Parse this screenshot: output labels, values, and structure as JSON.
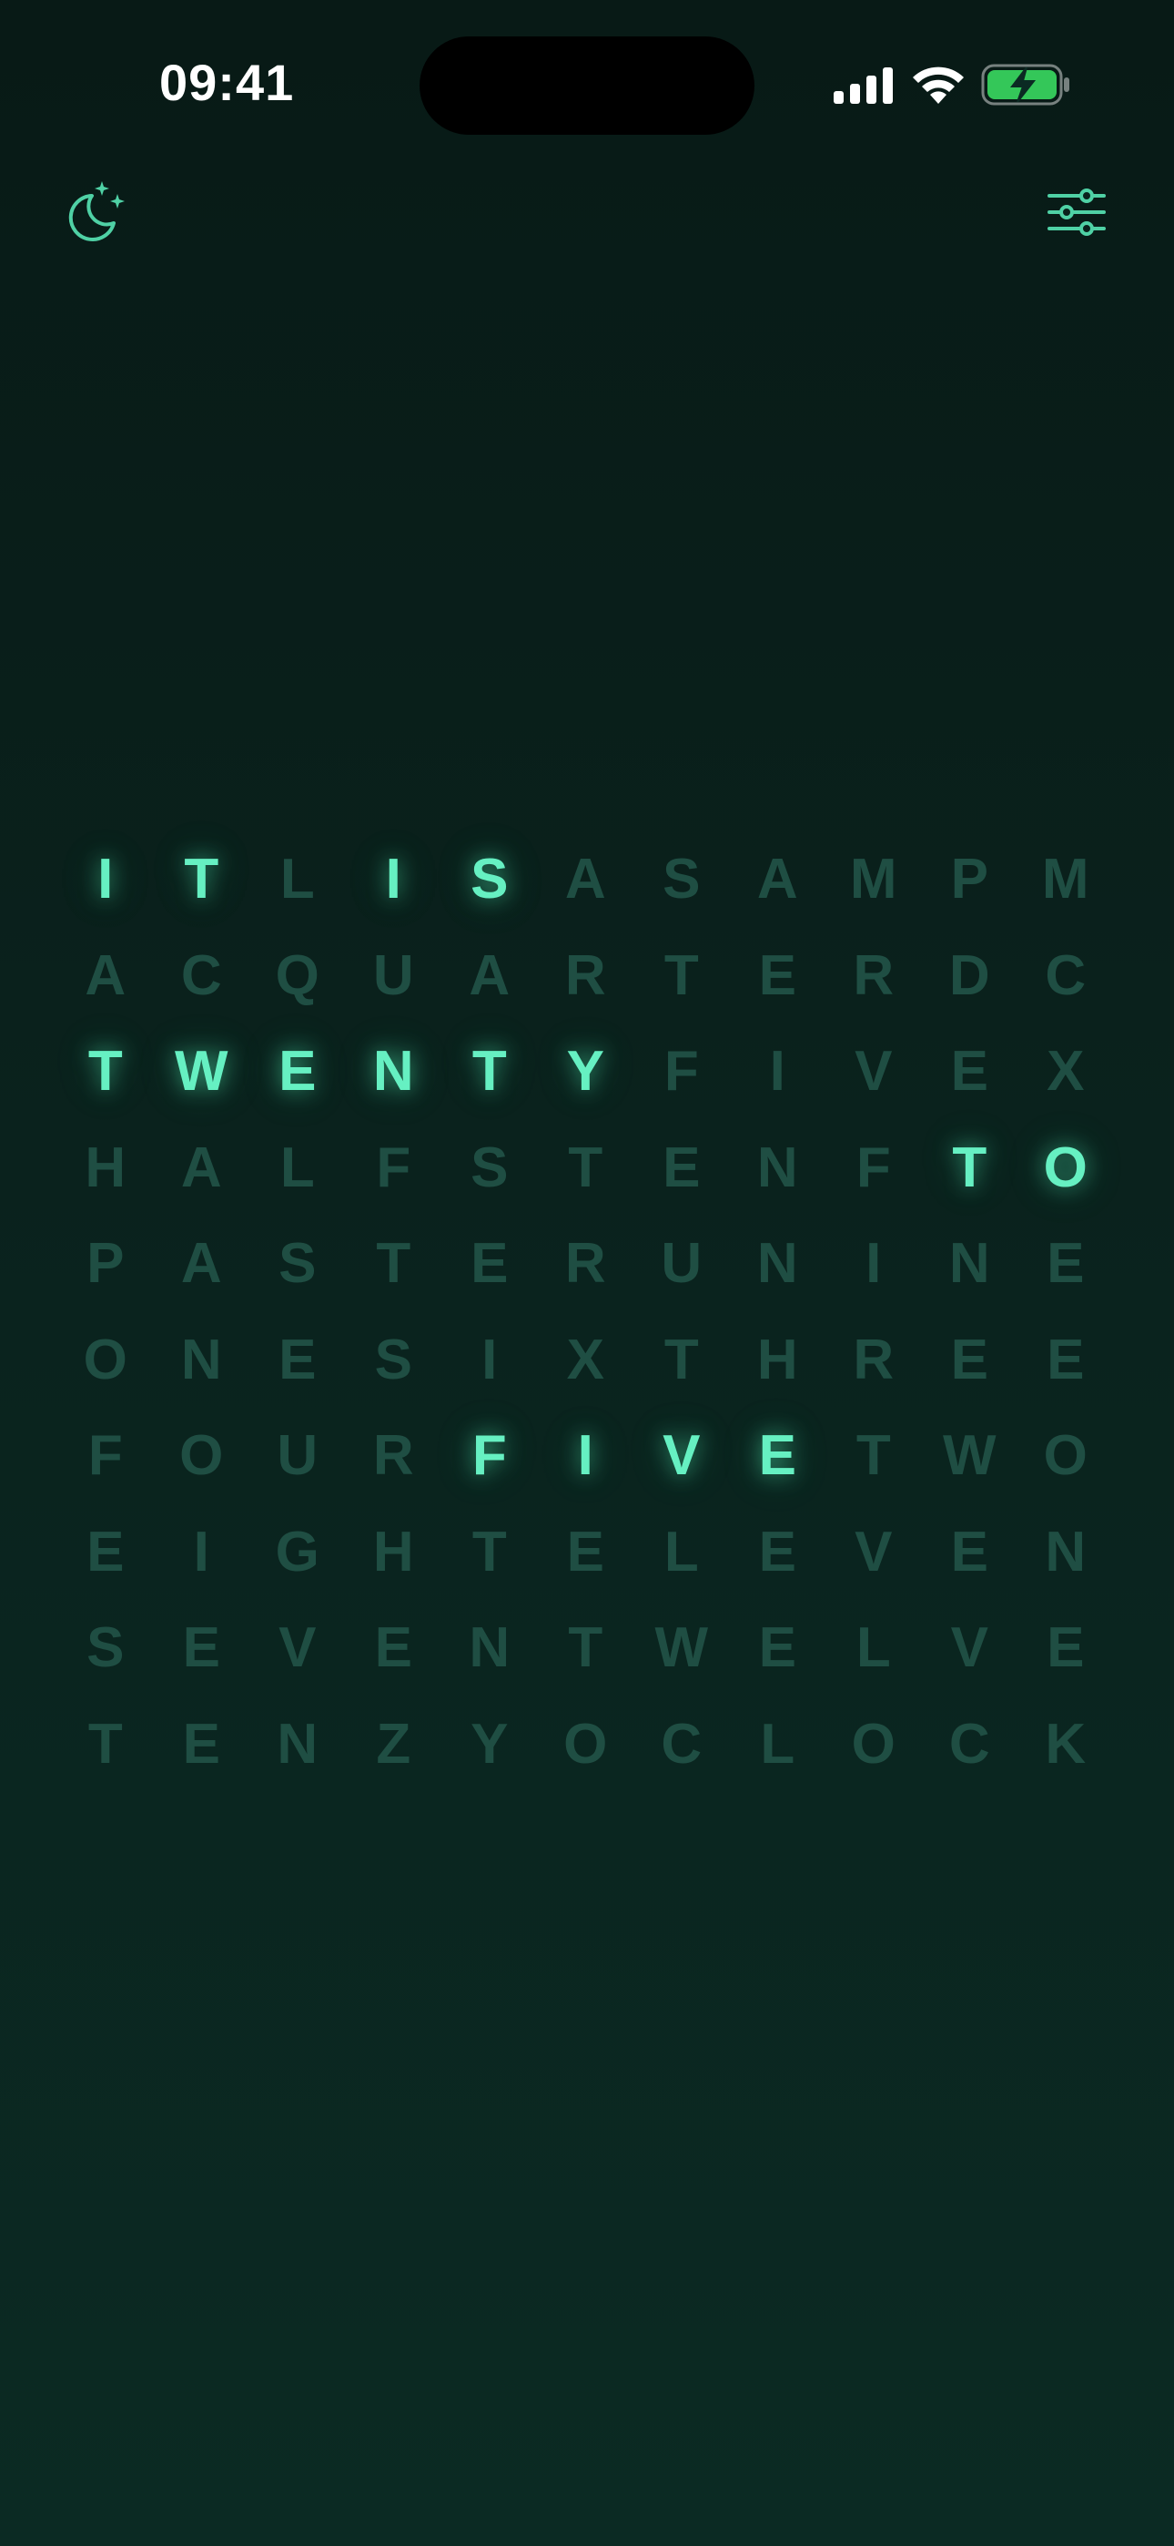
{
  "status_bar": {
    "time": "09:41",
    "icons": [
      "cellular-signal-icon",
      "wifi-icon",
      "battery-charging-icon"
    ]
  },
  "toolbar": {
    "left_icon": "night-mode-icon",
    "right_icon": "settings-sliders-icon"
  },
  "colors": {
    "background": "#0a221d",
    "lit_letter": "#66f0c2",
    "dim_letter": "#1f4e43",
    "accent": "#4fd1a5",
    "battery_fill": "#34c759"
  },
  "clock": {
    "phrase": "IT IS TWENTY FIVE TO",
    "rows": [
      {
        "letters": [
          "I",
          "T",
          "L",
          "I",
          "S",
          "A",
          "S",
          "A",
          "M",
          "P",
          "M"
        ],
        "lit": [
          1,
          1,
          0,
          1,
          1,
          0,
          0,
          0,
          0,
          0,
          0
        ]
      },
      {
        "letters": [
          "A",
          "C",
          "Q",
          "U",
          "A",
          "R",
          "T",
          "E",
          "R",
          "D",
          "C"
        ],
        "lit": [
          0,
          0,
          0,
          0,
          0,
          0,
          0,
          0,
          0,
          0,
          0
        ]
      },
      {
        "letters": [
          "T",
          "W",
          "E",
          "N",
          "T",
          "Y",
          "F",
          "I",
          "V",
          "E",
          "X"
        ],
        "lit": [
          1,
          1,
          1,
          1,
          1,
          1,
          0,
          0,
          0,
          0,
          0
        ]
      },
      {
        "letters": [
          "H",
          "A",
          "L",
          "F",
          "S",
          "T",
          "E",
          "N",
          "F",
          "T",
          "O"
        ],
        "lit": [
          0,
          0,
          0,
          0,
          0,
          0,
          0,
          0,
          0,
          1,
          1
        ]
      },
      {
        "letters": [
          "P",
          "A",
          "S",
          "T",
          "E",
          "R",
          "U",
          "N",
          "I",
          "N",
          "E"
        ],
        "lit": [
          0,
          0,
          0,
          0,
          0,
          0,
          0,
          0,
          0,
          0,
          0
        ]
      },
      {
        "letters": [
          "O",
          "N",
          "E",
          "S",
          "I",
          "X",
          "T",
          "H",
          "R",
          "E",
          "E"
        ],
        "lit": [
          0,
          0,
          0,
          0,
          0,
          0,
          0,
          0,
          0,
          0,
          0
        ]
      },
      {
        "letters": [
          "F",
          "O",
          "U",
          "R",
          "F",
          "I",
          "V",
          "E",
          "T",
          "W",
          "O"
        ],
        "lit": [
          0,
          0,
          0,
          0,
          1,
          1,
          1,
          1,
          0,
          0,
          0
        ]
      },
      {
        "letters": [
          "E",
          "I",
          "G",
          "H",
          "T",
          "E",
          "L",
          "E",
          "V",
          "E",
          "N"
        ],
        "lit": [
          0,
          0,
          0,
          0,
          0,
          0,
          0,
          0,
          0,
          0,
          0
        ]
      },
      {
        "letters": [
          "S",
          "E",
          "V",
          "E",
          "N",
          "T",
          "W",
          "E",
          "L",
          "V",
          "E"
        ],
        "lit": [
          0,
          0,
          0,
          0,
          0,
          0,
          0,
          0,
          0,
          0,
          0
        ]
      },
      {
        "letters": [
          "T",
          "E",
          "N",
          "Z",
          "Y",
          "O",
          "C",
          "L",
          "O",
          "C",
          "K"
        ],
        "lit": [
          0,
          0,
          0,
          0,
          0,
          0,
          0,
          0,
          0,
          0,
          0
        ]
      }
    ]
  }
}
